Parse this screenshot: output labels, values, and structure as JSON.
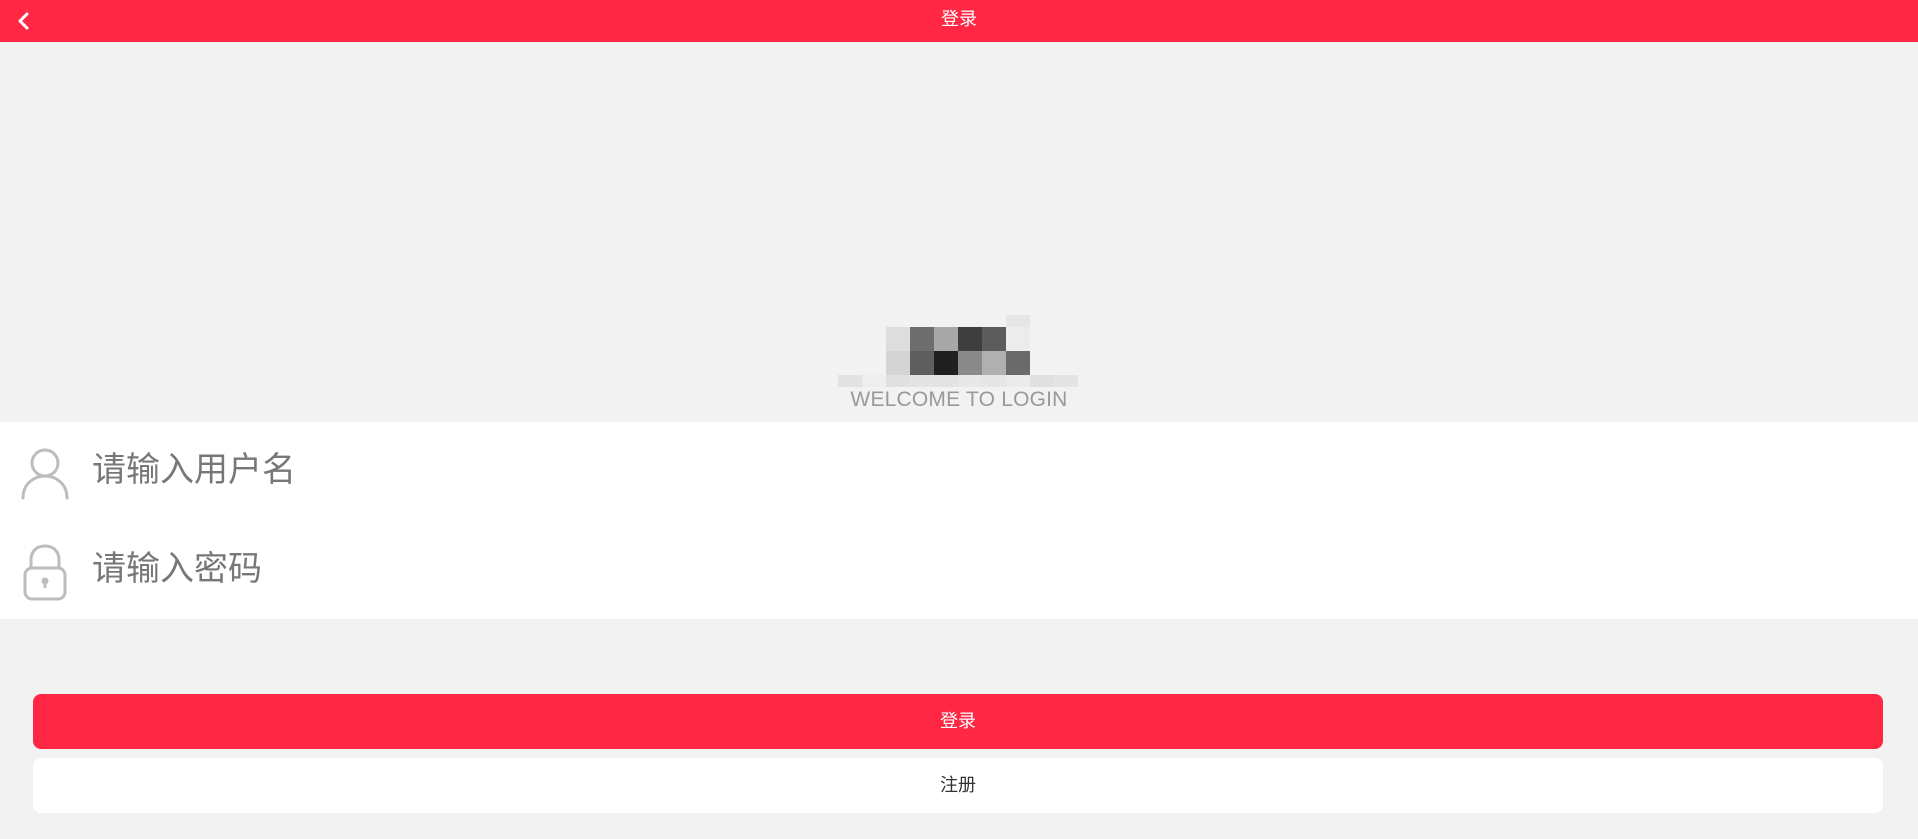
{
  "header": {
    "title": "登录",
    "back_icon": "chevron-left-icon",
    "background_color": "#ff2743"
  },
  "welcome": {
    "text": "WELCOME TO LOGIN"
  },
  "form": {
    "username": {
      "icon": "user-icon",
      "placeholder": "请输入用户名",
      "value": ""
    },
    "password": {
      "icon": "lock-icon",
      "placeholder": "请输入密码",
      "value": ""
    }
  },
  "actions": {
    "login_label": "登录",
    "register_label": "注册"
  },
  "colors": {
    "accent": "#ff2743",
    "page_background": "#f2f2f2",
    "muted_text": "#999999"
  }
}
